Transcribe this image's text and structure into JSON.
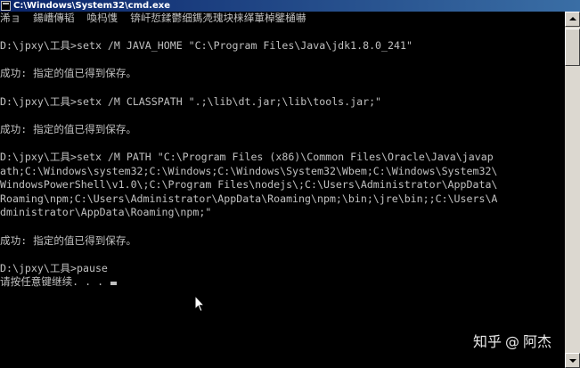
{
  "window": {
    "title": "C:\\Windows\\System32\\cmd.exe"
  },
  "console": {
    "lines": [
      "浠ョ  鍚嶆傳韬  喚杩愯  锛屽悊鍒鬱细鎷凴瑰块梾缂莗棹鐾樋嚇",
      "",
      "D:\\jpxy\\工具>setx /M JAVA_HOME \"C:\\Program Files\\Java\\jdk1.8.0_241\"",
      "",
      "成功: 指定的值已得到保存。",
      "",
      "D:\\jpxy\\工具>setx /M CLASSPATH \".;\\lib\\dt.jar;\\lib\\tools.jar;\"",
      "",
      "成功: 指定的值已得到保存。",
      "",
      "D:\\jpxy\\工具>setx /M PATH \"C:\\Program Files (x86)\\Common Files\\Oracle\\Java\\javap",
      "ath;C:\\Windows\\system32;C:\\Windows;C:\\Windows\\System32\\Wbem;C:\\Windows\\System32\\",
      "WindowsPowerShell\\v1.0\\;C:\\Program Files\\nodejs\\;C:\\Users\\Administrator\\AppData\\",
      "Roaming\\npm;C:\\Users\\Administrator\\AppData\\Roaming\\npm;\\bin;\\jre\\bin;;C:\\Users\\A",
      "dministrator\\AppData\\Roaming\\npm;\"",
      "",
      "成功: 指定的值已得到保存。",
      "",
      "D:\\jpxy\\工具>pause",
      "请按任意键继续. . . "
    ]
  },
  "watermark": {
    "brand": "知乎",
    "separator": "@",
    "author": "阿杰"
  },
  "colors": {
    "console_background": "#000000",
    "console_text": "#c0c0c0",
    "titlebar_start": "#0a246a",
    "titlebar_end": "#3a6ea5",
    "scrollbar": "#d4d0c8"
  },
  "icons": {
    "titlebar": "cmd-app-icon",
    "pointer": "mouse-pointer-icon",
    "scroll_up": "scroll-up-arrow-icon",
    "scroll_down": "scroll-down-arrow-icon"
  }
}
